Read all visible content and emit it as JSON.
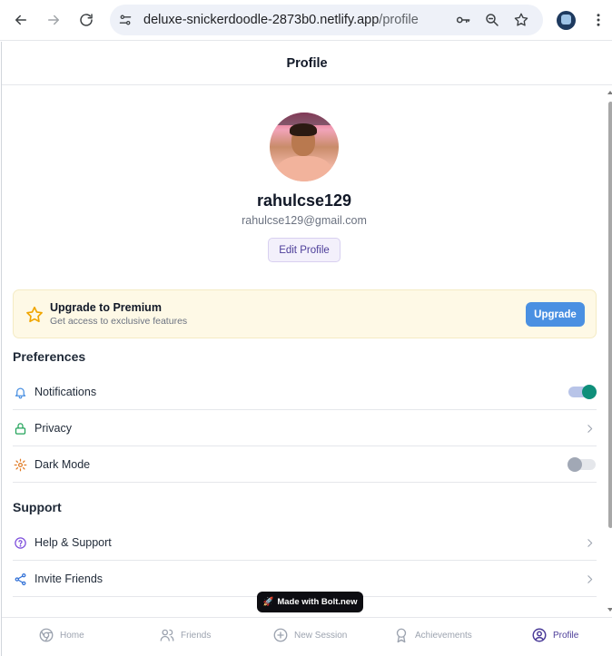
{
  "browser": {
    "url_host": "deluxe-snickerdoodle-2873b0.netlify.app",
    "url_path": "/profile",
    "icons": [
      "back-arrow-icon",
      "forward-arrow-icon",
      "reload-icon",
      "site-info-icon",
      "password-key-icon",
      "zoom-icon",
      "bookmark-star-icon",
      "profile-avatar",
      "more-menu-icon"
    ]
  },
  "header": {
    "title": "Profile"
  },
  "profile": {
    "username": "rahulcse129",
    "email": "rahulcse129@gmail.com",
    "edit_label": "Edit Profile"
  },
  "premium": {
    "title": "Upgrade to Premium",
    "subtitle": "Get access to exclusive features",
    "button_label": "Upgrade",
    "icon": "star-icon"
  },
  "preferences": {
    "title": "Preferences",
    "items": [
      {
        "label": "Notifications",
        "icon": "bell-icon",
        "control": "toggle",
        "enabled": true
      },
      {
        "label": "Privacy",
        "icon": "lock-icon",
        "control": "chevron"
      },
      {
        "label": "Dark Mode",
        "icon": "gear-icon",
        "control": "toggle",
        "enabled": false
      }
    ]
  },
  "support": {
    "title": "Support",
    "items": [
      {
        "label": "Help & Support",
        "icon": "help-circle-icon",
        "control": "chevron"
      },
      {
        "label": "Invite Friends",
        "icon": "share-icon",
        "control": "chevron"
      }
    ]
  },
  "bottom_nav": {
    "tabs": [
      {
        "label": "Home",
        "icon": "chrome-home-icon",
        "active": false
      },
      {
        "label": "Friends",
        "icon": "users-icon",
        "active": false
      },
      {
        "label": "New Session",
        "icon": "plus-circle-icon",
        "active": false
      },
      {
        "label": "Achievements",
        "icon": "award-icon",
        "active": false
      },
      {
        "label": "Profile",
        "icon": "user-circle-icon",
        "active": true
      }
    ]
  },
  "badge": {
    "label": "Made with Bolt.new"
  },
  "colors": {
    "accent": "#4c3d99",
    "upgrade_button": "#4a90e2",
    "premium_bg": "#fef9e6",
    "toggle_on": "#0f8f7a"
  }
}
